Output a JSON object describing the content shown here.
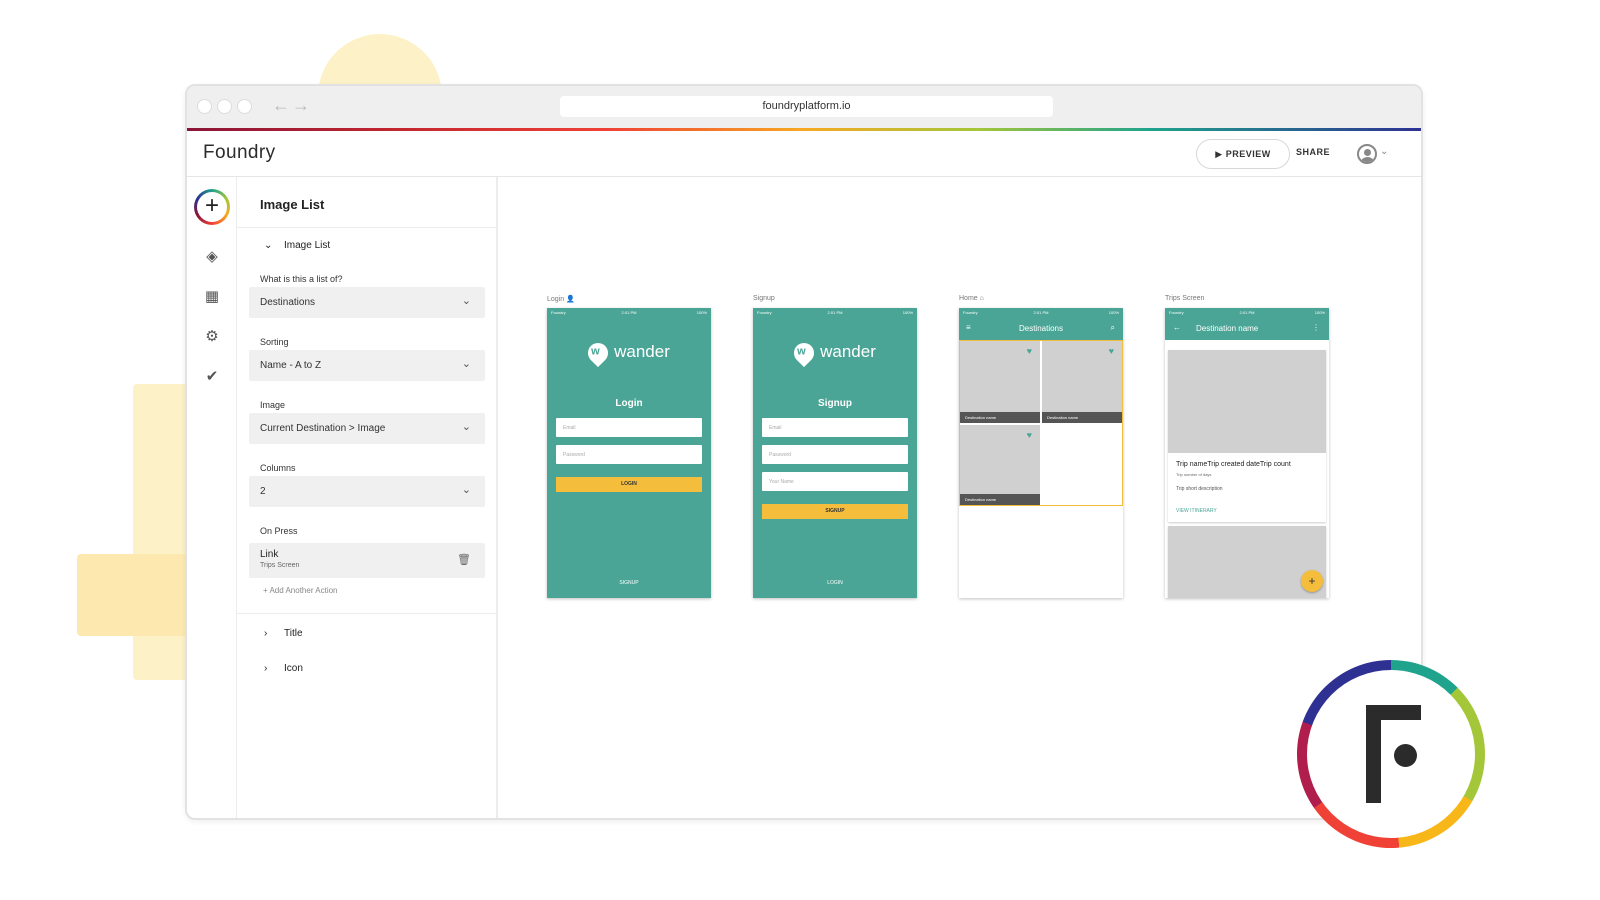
{
  "browser": {
    "url": "foundryplatform.io"
  },
  "app": {
    "logo_text": "Foundry",
    "preview_label": "PREVIEW",
    "share_label": "SHARE"
  },
  "rail": {
    "add_symbol": "+",
    "icons": [
      "layers-icon",
      "grid-icon",
      "gear-icon",
      "double-check-icon"
    ]
  },
  "panel": {
    "title": "Image List",
    "section_title": "Image List",
    "fields": [
      {
        "label": "What is this a list of?",
        "value": "Destinations"
      },
      {
        "label": "Sorting",
        "value": "Name - A to Z"
      },
      {
        "label": "Image",
        "value": "Current Destination > Image"
      },
      {
        "label": "Columns",
        "value": "2"
      }
    ],
    "on_press": {
      "label": "On Press",
      "action_title": "Link",
      "action_subtitle": "Trips Screen",
      "add_action": "+ Add Another Action"
    },
    "collapsed_sections": [
      "Title",
      "Icon"
    ]
  },
  "screens": {
    "status": {
      "carrier": "Foundry",
      "time": "2:01 PM",
      "battery": "100%"
    },
    "login": {
      "label": "Login",
      "brand": "wander",
      "title": "Login",
      "inputs": [
        "Email",
        "Password"
      ],
      "button": "LOGIN",
      "footer": "SIGNUP"
    },
    "signup": {
      "label": "Signup",
      "brand": "wander",
      "title": "Signup",
      "inputs": [
        "Email",
        "Password",
        "Your Name"
      ],
      "button": "SIGNUP",
      "footer": "LOGIN"
    },
    "home": {
      "label": "Home",
      "title": "Destinations",
      "tiles": [
        "Destination name",
        "Destination name",
        "Destination name"
      ]
    },
    "trips": {
      "label": "Trips Screen",
      "title": "Destination name",
      "card_title": "Trip nameTrip created dateTrip count",
      "card_sub": "Trip number of days",
      "card_desc": "Trip short description",
      "card_link": "VIEW ITINERARY",
      "fab": "+"
    }
  },
  "colors": {
    "teal": "#4aa596",
    "yellow": "#f4be3c"
  }
}
